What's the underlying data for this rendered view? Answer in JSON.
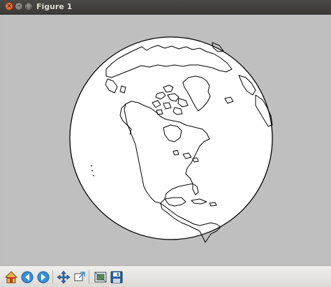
{
  "window": {
    "title": "Figure 1",
    "controls": [
      "close",
      "minimize",
      "maximize"
    ]
  },
  "figure": {
    "projection": "orthographic",
    "background_color": "#bfbfbf",
    "globe_fill": "#ffffff",
    "coastline_color": "#000000"
  },
  "toolbar": {
    "buttons": [
      {
        "name": "home-icon"
      },
      {
        "name": "back-icon"
      },
      {
        "name": "forward-icon"
      },
      {
        "name": "pan-icon"
      },
      {
        "name": "zoom-icon"
      },
      {
        "name": "configure-subplots-icon"
      },
      {
        "name": "save-icon"
      }
    ]
  }
}
